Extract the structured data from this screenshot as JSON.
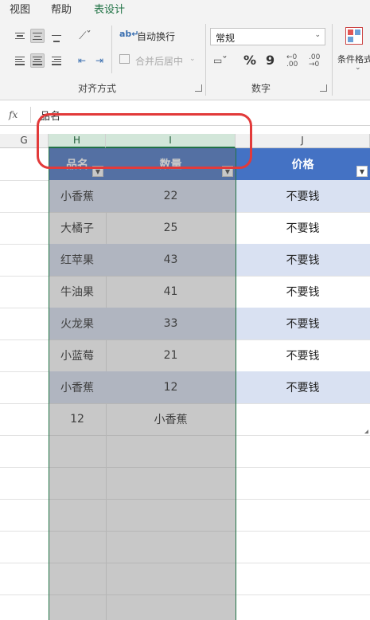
{
  "ribbon": {
    "tabs": [
      "视图",
      "帮助",
      "表设计"
    ],
    "wrap_text": "自动换行",
    "merge_center": "合并后居中",
    "alignment_group": "对齐方式",
    "number_format_value": "常规",
    "currency_symbol": "%",
    "comma_symbol": "9",
    "number_group": "数字",
    "conditional_format": "条件格式"
  },
  "formula_bar": {
    "fx": "fx",
    "content": "品名"
  },
  "columns": [
    "G",
    "H",
    "I",
    "J"
  ],
  "table": {
    "headers": [
      "品名",
      "数量",
      "价格"
    ],
    "rows": [
      [
        "小香蕉",
        "22",
        "不要钱"
      ],
      [
        "大橘子",
        "25",
        "不要钱"
      ],
      [
        "红苹果",
        "43",
        "不要钱"
      ],
      [
        "牛油果",
        "41",
        "不要钱"
      ],
      [
        "火龙果",
        "33",
        "不要钱"
      ],
      [
        "小蓝莓",
        "21",
        "不要钱"
      ],
      [
        "小香蕉",
        "12",
        "不要钱"
      ]
    ],
    "extra_row": [
      "12",
      "小香蕉",
      ""
    ]
  },
  "colors": {
    "header": "#4472c4",
    "band": "#d9e1f2",
    "accent": "#217346",
    "annotation": "#e23a3a"
  }
}
